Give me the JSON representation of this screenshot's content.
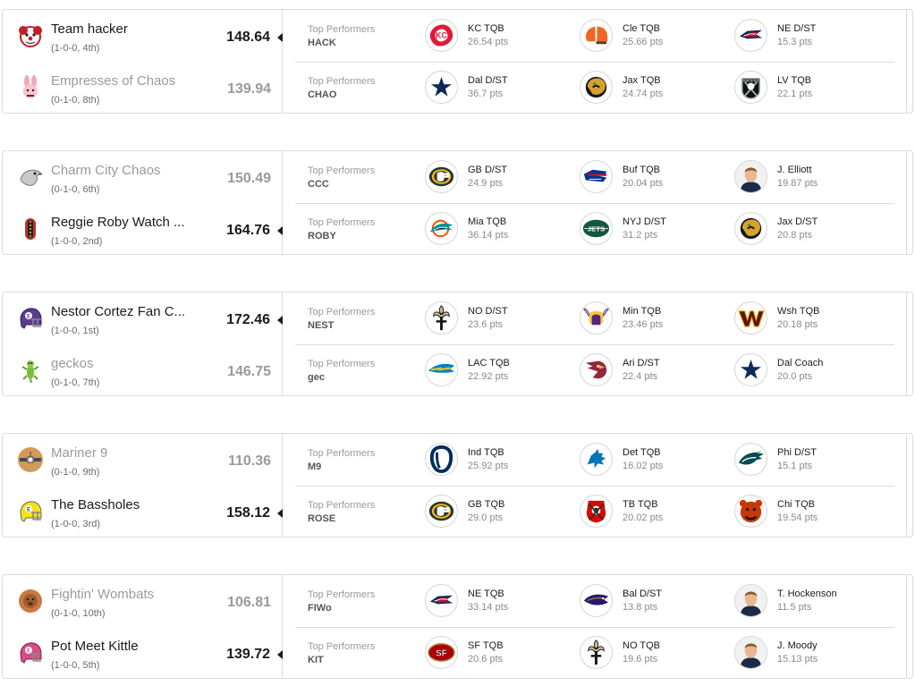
{
  "matchups": [
    {
      "teams": [
        {
          "name": "Team hacker",
          "record": "(1-0-0, 4th)",
          "score": "148.64",
          "abbr": "HACK",
          "winner": true,
          "avatar": "clown-icon",
          "performers": [
            {
              "label": "KC TQB",
              "pts": "26.54 pts",
              "logo": "chiefs-logo-icon"
            },
            {
              "label": "Cle TQB",
              "pts": "25.66 pts",
              "logo": "browns-logo-icon"
            },
            {
              "label": "NE D/ST",
              "pts": "15.3 pts",
              "logo": "patriots-logo-icon"
            }
          ]
        },
        {
          "name": "Empresses of Chaos",
          "record": "(0-1-0, 8th)",
          "score": "139.94",
          "abbr": "CHAO",
          "winner": false,
          "avatar": "bunny-icon",
          "performers": [
            {
              "label": "Dal D/ST",
              "pts": "36.7 pts",
              "logo": "cowboys-logo-icon"
            },
            {
              "label": "Jax TQB",
              "pts": "24.74 pts",
              "logo": "jaguars-logo-icon"
            },
            {
              "label": "LV TQB",
              "pts": "22.1 pts",
              "logo": "raiders-logo-icon"
            }
          ]
        }
      ]
    },
    {
      "teams": [
        {
          "name": "Charm City Chaos",
          "record": "(0-1-0, 6th)",
          "score": "150.49",
          "abbr": "CCC",
          "winner": false,
          "avatar": "raven-icon",
          "performers": [
            {
              "label": "GB D/ST",
              "pts": "24.9 pts",
              "logo": "packers-logo-icon"
            },
            {
              "label": "Buf TQB",
              "pts": "20.04 pts",
              "logo": "bills-logo-icon"
            },
            {
              "label": "J. Elliott",
              "pts": "19.87 pts",
              "logo": "player-headshot-icon"
            }
          ]
        },
        {
          "name": "Reggie Roby Watch ...",
          "record": "(1-0-0, 2nd)",
          "score": "164.76",
          "abbr": "ROBY",
          "winner": true,
          "avatar": "hotdog-icon",
          "performers": [
            {
              "label": "Mia TQB",
              "pts": "36.14 pts",
              "logo": "dolphins-logo-icon"
            },
            {
              "label": "NYJ D/ST",
              "pts": "31.2 pts",
              "logo": "jets-logo-icon"
            },
            {
              "label": "Jax D/ST",
              "pts": "20.8 pts",
              "logo": "jaguars-logo-icon"
            }
          ]
        }
      ]
    },
    {
      "teams": [
        {
          "name": "Nestor Cortez Fan C...",
          "record": "(1-0-0, 1st)",
          "score": "172.46",
          "abbr": "NEST",
          "winner": true,
          "avatar": "helmet-purple-icon",
          "performers": [
            {
              "label": "NO D/ST",
              "pts": "23.6 pts",
              "logo": "saints-logo-icon"
            },
            {
              "label": "Min TQB",
              "pts": "23.46 pts",
              "logo": "vikings-logo-icon"
            },
            {
              "label": "Wsh TQB",
              "pts": "20.18 pts",
              "logo": "commanders-logo-icon"
            }
          ]
        },
        {
          "name": "geckos",
          "record": "(0-1-0, 7th)",
          "score": "146.75",
          "abbr": "gec",
          "winner": false,
          "avatar": "gecko-icon",
          "performers": [
            {
              "label": "LAC TQB",
              "pts": "22.92 pts",
              "logo": "chargers-logo-icon"
            },
            {
              "label": "Ari D/ST",
              "pts": "22.4 pts",
              "logo": "cardinals-logo-icon"
            },
            {
              "label": "Dal Coach",
              "pts": "20.0 pts",
              "logo": "cowboys-logo-icon"
            }
          ]
        }
      ]
    },
    {
      "teams": [
        {
          "name": "Mariner 9",
          "record": "(0-1-0, 9th)",
          "score": "110.36",
          "abbr": "M9",
          "winner": false,
          "avatar": "satellite-icon",
          "performers": [
            {
              "label": "Ind TQB",
              "pts": "25.92 pts",
              "logo": "colts-logo-icon"
            },
            {
              "label": "Det TQB",
              "pts": "16.02 pts",
              "logo": "lions-logo-icon"
            },
            {
              "label": "Phi D/ST",
              "pts": "15.1 pts",
              "logo": "eagles-logo-icon"
            }
          ]
        },
        {
          "name": "The Bassholes",
          "record": "(1-0-0, 3rd)",
          "score": "158.12",
          "abbr": "ROSE",
          "winner": true,
          "avatar": "helmet-yellow-icon",
          "performers": [
            {
              "label": "GB TQB",
              "pts": "29.0 pts",
              "logo": "packers-logo-icon"
            },
            {
              "label": "TB TQB",
              "pts": "20.02 pts",
              "logo": "buccaneers-logo-icon"
            },
            {
              "label": "Chi TQB",
              "pts": "19.54 pts",
              "logo": "bears-logo-icon"
            }
          ]
        }
      ]
    },
    {
      "teams": [
        {
          "name": "Fightin' Wombats",
          "record": "(0-1-0, 10th)",
          "score": "106.81",
          "abbr": "FIWo",
          "winner": false,
          "avatar": "wombat-icon",
          "performers": [
            {
              "label": "NE TQB",
              "pts": "33.14 pts",
              "logo": "patriots-logo-icon"
            },
            {
              "label": "Bal D/ST",
              "pts": "13.8 pts",
              "logo": "ravens-logo-icon"
            },
            {
              "label": "T. Hockenson",
              "pts": "11.5 pts",
              "logo": "player-headshot-icon"
            }
          ]
        },
        {
          "name": "Pot Meet Kittle",
          "record": "(1-0-0, 5th)",
          "score": "139.72",
          "abbr": "KIT",
          "winner": true,
          "avatar": "helmet-pink-icon",
          "performers": [
            {
              "label": "SF TQB",
              "pts": "20.6 pts",
              "logo": "49ers-logo-icon"
            },
            {
              "label": "NO TQB",
              "pts": "19.6 pts",
              "logo": "saints-logo-icon"
            },
            {
              "label": "J. Moody",
              "pts": "15.13 pts",
              "logo": "player-headshot-icon"
            }
          ]
        }
      ]
    }
  ],
  "labels": {
    "top_performers": "Top Performers"
  },
  "colors": {
    "winner_text": "#1a1a1a",
    "loser_text": "#9a9a9a",
    "border": "#dcdcdc"
  }
}
